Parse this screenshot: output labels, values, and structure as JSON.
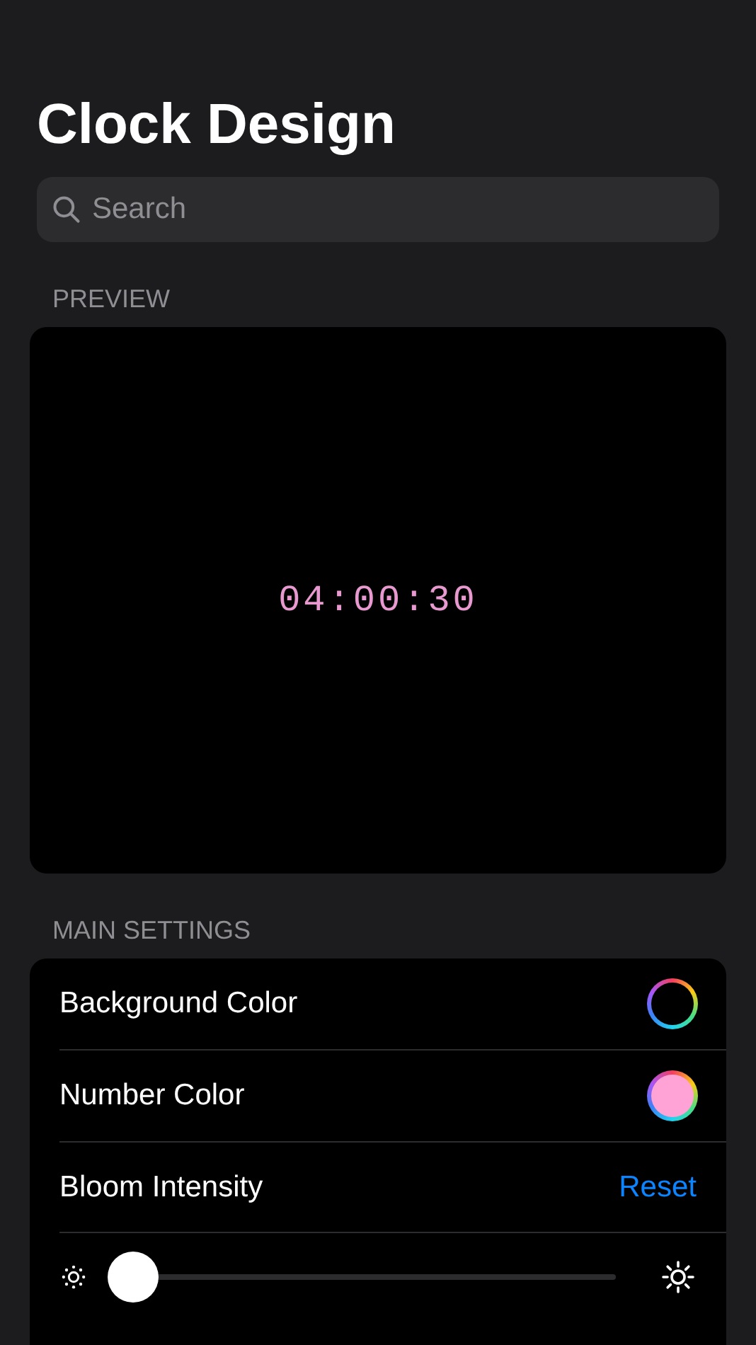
{
  "title": "Clock Design",
  "search": {
    "placeholder": "Search"
  },
  "preview": {
    "header": "PREVIEW",
    "time": "04:00:30"
  },
  "main_settings": {
    "header": "MAIN SETTINGS",
    "rows": [
      {
        "kind": "color",
        "label": "Background Color",
        "color": "#000000"
      },
      {
        "kind": "color",
        "label": "Number Color",
        "color": "#ffa3d7"
      },
      {
        "kind": "action",
        "label": "Bloom Intensity",
        "action": "Reset"
      },
      {
        "kind": "slider",
        "level": 0
      }
    ]
  }
}
